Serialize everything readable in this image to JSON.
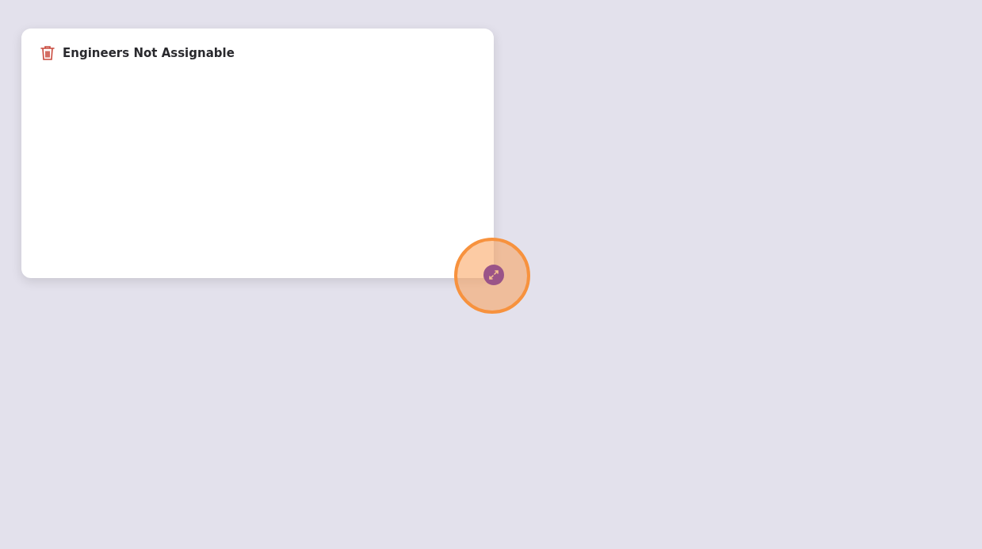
{
  "card": {
    "title": "Engineers Not Assignable"
  }
}
